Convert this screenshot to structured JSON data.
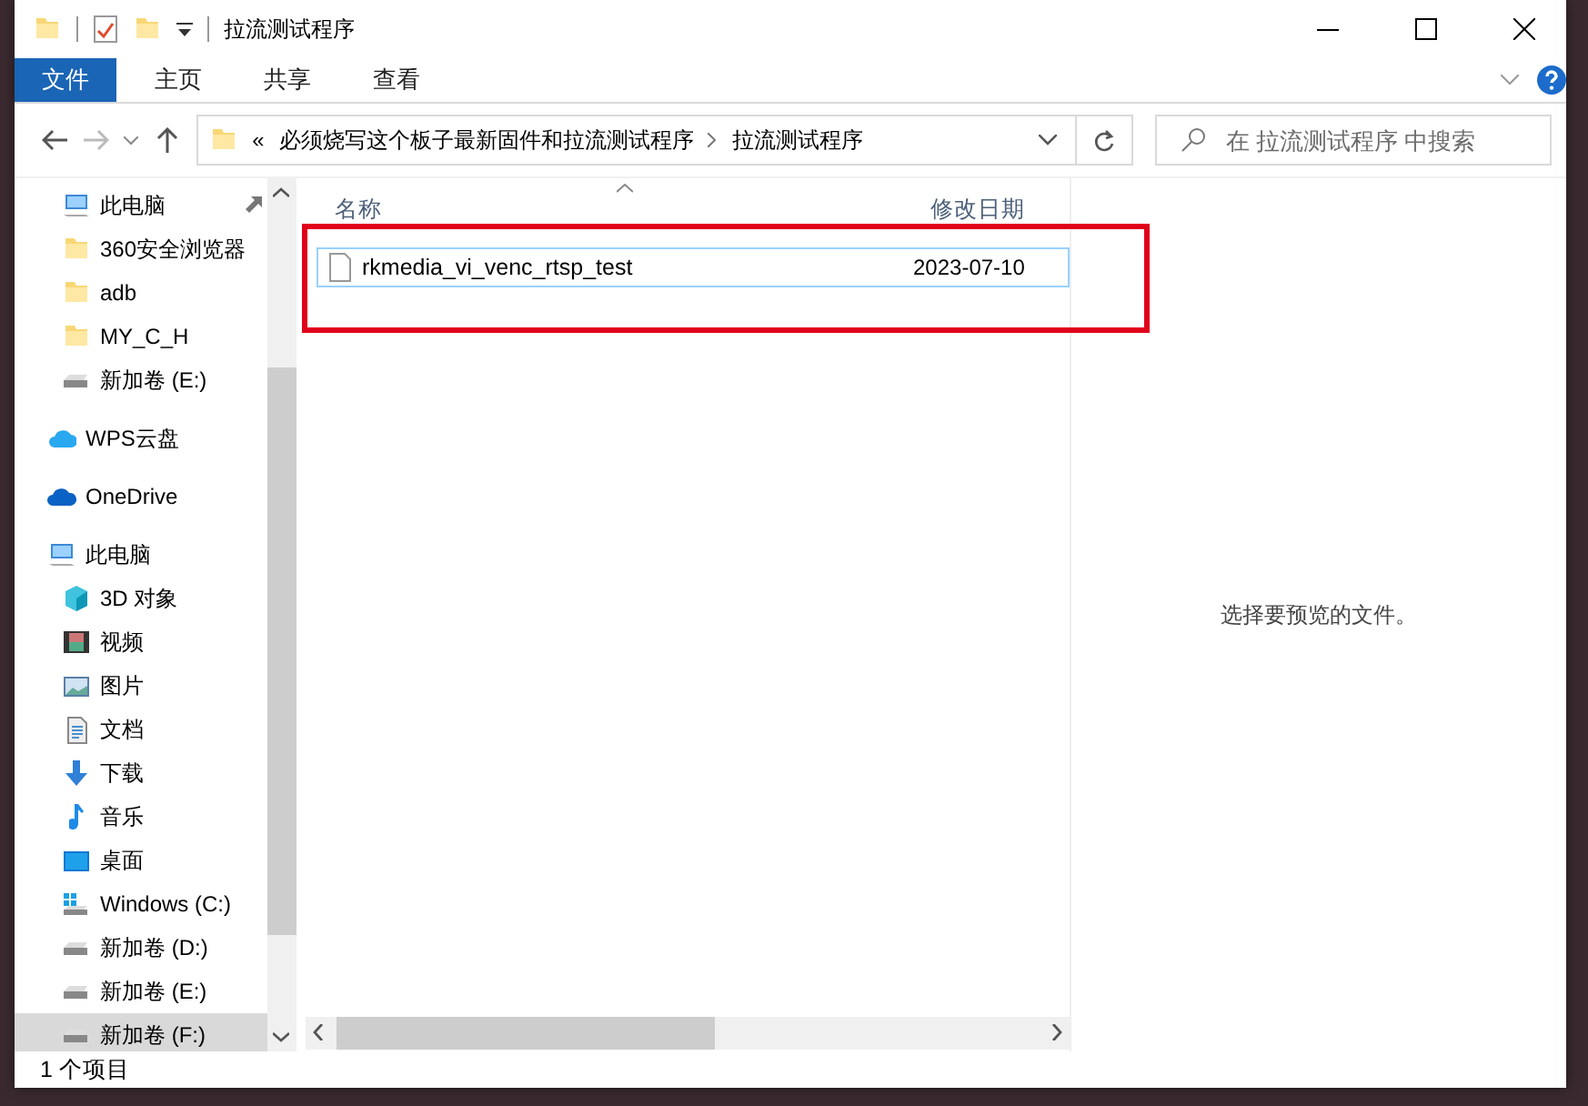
{
  "window": {
    "title": "拉流测试程序"
  },
  "ribbon": {
    "tabs": [
      {
        "label": "文件",
        "kind": "file"
      },
      {
        "label": "主页",
        "kind": "tab"
      },
      {
        "label": "共享",
        "kind": "tab"
      },
      {
        "label": "查看",
        "kind": "tab"
      }
    ]
  },
  "navigation": {
    "address": {
      "overflow": "«",
      "crumbs": [
        "必须烧写这个板子最新固件和拉流测试程序",
        "拉流测试程序"
      ]
    },
    "search": {
      "placeholder": "在 拉流测试程序 中搜索"
    }
  },
  "sidebar": {
    "quick_access": [
      {
        "label": "此电脑",
        "kind": "pc",
        "pinned": true,
        "selected": false
      },
      {
        "label": "360安全浏览器",
        "kind": "folder",
        "selected": false
      },
      {
        "label": "adb",
        "kind": "folder",
        "selected": false
      },
      {
        "label": "MY_C_H",
        "kind": "folder",
        "selected": false
      },
      {
        "label": "新加卷 (E:)",
        "kind": "drive",
        "selected": false
      }
    ],
    "items": [
      {
        "label": "WPS云盘",
        "kind": "wps",
        "selected": false
      },
      {
        "label": "OneDrive",
        "kind": "onedrive",
        "selected": false
      },
      {
        "label": "此电脑",
        "kind": "pc",
        "selected": false,
        "children": [
          {
            "label": "3D 对象",
            "kind": "cube",
            "selected": false
          },
          {
            "label": "视频",
            "kind": "video",
            "selected": false
          },
          {
            "label": "图片",
            "kind": "picture",
            "selected": false
          },
          {
            "label": "文档",
            "kind": "document",
            "selected": false
          },
          {
            "label": "下载",
            "kind": "download",
            "selected": false
          },
          {
            "label": "音乐",
            "kind": "music",
            "selected": false
          },
          {
            "label": "桌面",
            "kind": "desktop",
            "selected": false
          },
          {
            "label": "Windows (C:)",
            "kind": "windrive",
            "selected": false
          },
          {
            "label": "新加卷 (D:)",
            "kind": "drive",
            "selected": false
          },
          {
            "label": "新加卷 (E:)",
            "kind": "drive",
            "selected": false
          },
          {
            "label": "新加卷 (F:)",
            "kind": "drive",
            "selected": true
          }
        ]
      }
    ]
  },
  "file_list": {
    "columns": [
      {
        "label": "名称",
        "sorted": true
      },
      {
        "label": "修改日期",
        "sorted": false
      }
    ],
    "files": [
      {
        "name": "rkmedia_vi_venc_rtsp_test",
        "modified": "2023-07-10",
        "selected": true,
        "highlighted": true
      }
    ]
  },
  "preview": {
    "message": "选择要预览的文件。"
  },
  "status_bar": {
    "item_count": "1 个项目"
  }
}
